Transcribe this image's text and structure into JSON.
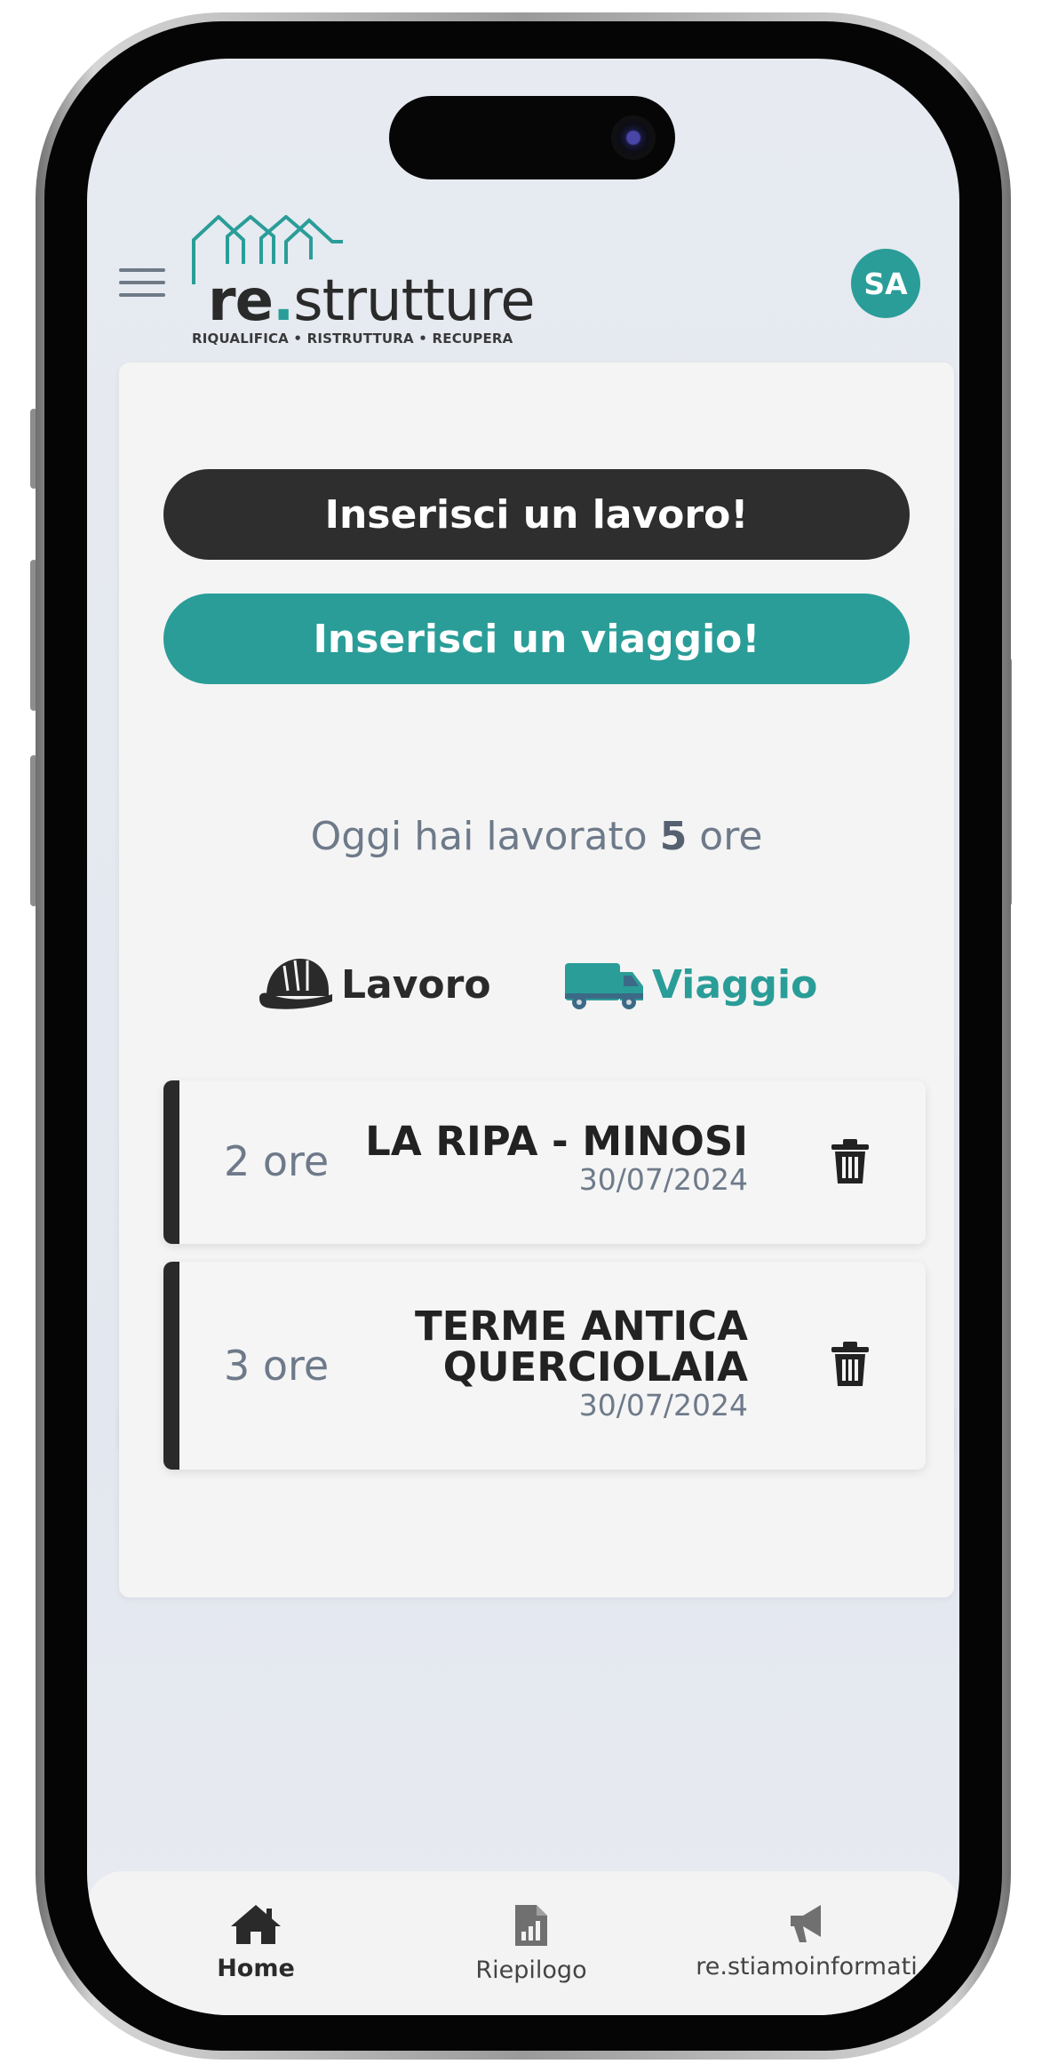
{
  "header": {
    "logo_prefix": "re",
    "logo_dot": ".",
    "logo_suffix": "strutture",
    "logo_tagline": "RIQUALIFICA • RISTRUTTURA • RECUPERA",
    "avatar_initials": "SA"
  },
  "actions": {
    "add_work_label": "Inserisci un lavoro!",
    "add_trip_label": "Inserisci un viaggio!"
  },
  "summary": {
    "prefix": "Oggi hai lavorato ",
    "hours": "5",
    "suffix": " ore"
  },
  "tabs": [
    {
      "label": "Lavoro",
      "icon": "hard-hat-icon"
    },
    {
      "label": "Viaggio",
      "icon": "van-icon"
    }
  ],
  "entries": [
    {
      "hours": "2 ore",
      "name_line1": "LA RIPA - MINOSI",
      "name_line2": "",
      "date": "30/07/2024"
    },
    {
      "hours": "3 ore",
      "name_line1": "TERME ANTICA",
      "name_line2": "QUERCIOLAIA",
      "date": "30/07/2024"
    }
  ],
  "nav": [
    {
      "label": "Home",
      "icon": "home-icon"
    },
    {
      "label": "Riepilogo",
      "icon": "report-icon"
    },
    {
      "label": "re.stiamoinformati",
      "icon": "megaphone-icon"
    }
  ],
  "colors": {
    "accent": "#2a9d98",
    "dark": "#2e2e2e",
    "muted_text": "#6e7a8a"
  }
}
